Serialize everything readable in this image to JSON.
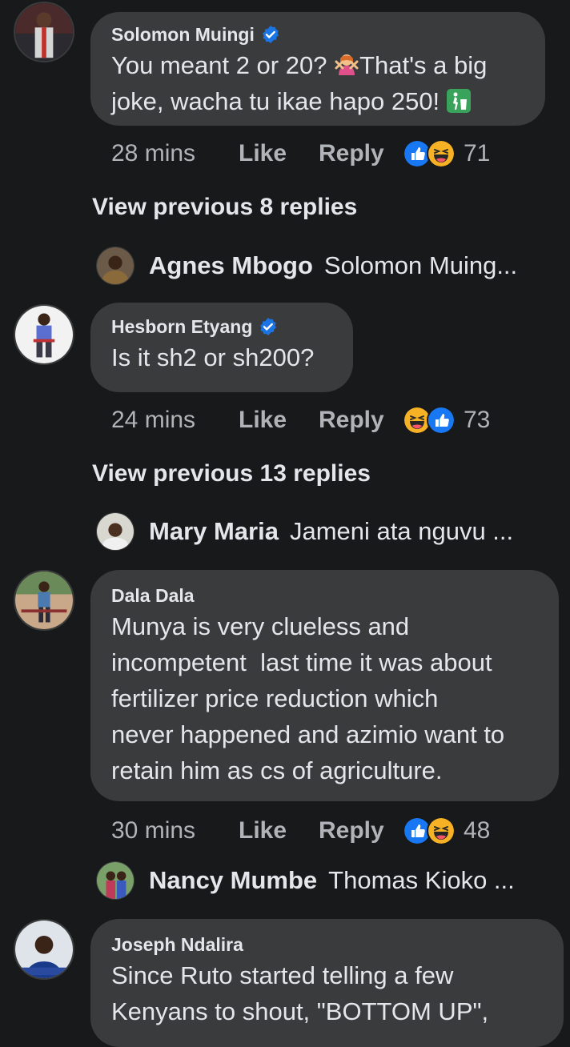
{
  "colors": {
    "background": "#18191a",
    "bubble": "#3a3b3c",
    "text_primary": "#e4e6eb",
    "text_secondary": "#b0b3b8",
    "verified_blue": "#1b74e4",
    "like_blue": "#1877f2",
    "haha_yellow": "#f7b125"
  },
  "comments": [
    {
      "author": "Solomon Muingi",
      "verified": true,
      "text_part1": "You meant 2 or 20? ",
      "emoji1": "person-gesturing-no-emoji",
      "text_part2": "That's a big",
      "text_line2": "joke, wacha tu ikae hapo 250! ",
      "emoji2": "litter-bin-emoji",
      "time": "28 mins",
      "like_label": "Like",
      "reply_label": "Reply",
      "reactions": [
        "like-reaction-icon",
        "haha-reaction-icon"
      ],
      "reaction_count": "71"
    },
    {
      "author": "Hesborn Etyang",
      "verified": true,
      "text_line1": "Is it sh2 or sh200?",
      "time": "24 mins",
      "like_label": "Like",
      "reply_label": "Reply",
      "reactions": [
        "haha-reaction-icon",
        "like-reaction-icon"
      ],
      "reaction_count": "73"
    },
    {
      "author": "Dala Dala",
      "verified": false,
      "lines": [
        "Munya is very clueless and",
        "incompetent  last time it was about",
        "fertilizer price reduction which",
        "never happened and azimio want to",
        "retain him as cs of agriculture."
      ],
      "time": "30 mins",
      "like_label": "Like",
      "reply_label": "Reply",
      "reactions": [
        "like-reaction-icon",
        "haha-reaction-icon"
      ],
      "reaction_count": "48"
    },
    {
      "author": "Joseph Ndalira",
      "verified": false,
      "lines": [
        "Since Ruto started telling a few",
        "Kenyans to shout, \"BOTTOM UP\","
      ]
    }
  ],
  "view_previous": [
    "View previous 8 replies",
    "View previous 13 replies"
  ],
  "collapsed_replies": [
    {
      "name": "Agnes Mbogo",
      "snippet": "Solomon Muing..."
    },
    {
      "name": "Mary Maria",
      "snippet": "Jameni ata nguvu ..."
    },
    {
      "name": "Nancy Mumbe",
      "snippet": "Thomas Kioko ..."
    }
  ]
}
